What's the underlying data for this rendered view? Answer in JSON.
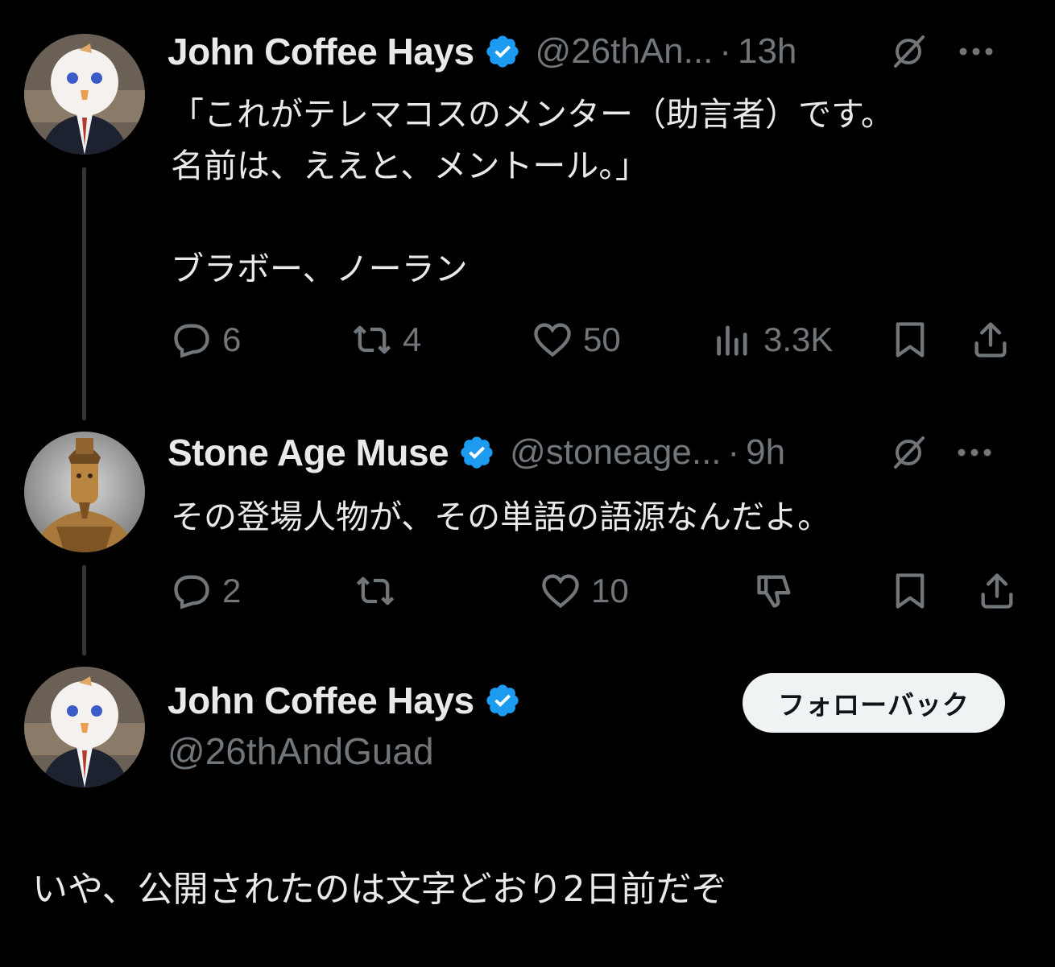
{
  "tweets": [
    {
      "name": "John Coffee Hays",
      "handle": "@26thAn...",
      "separator": "·",
      "time": "13h",
      "text": "「これがテレマコスのメンター（助言者）です。\n名前は、ええと、メントール。」\n\nブラボー、ノーラン",
      "replies": "6",
      "reposts": "4",
      "likes": "50",
      "views": "3.3K"
    },
    {
      "name": "Stone Age Muse",
      "handle": "@stoneage...",
      "separator": "·",
      "time": "9h",
      "text": "その登場人物が、その単語の語源なんだよ。",
      "replies": "2",
      "reposts": "",
      "likes": "10"
    }
  ],
  "main": {
    "name": "John Coffee Hays",
    "handle": "@26thAndGuad",
    "follow_label": "フォローバック",
    "text": "いや、公開されたのは文字どおり2日前だぞ"
  },
  "colors": {
    "background": "#000000",
    "text": "#e7e9ea",
    "muted": "#71767b",
    "verified": "#1d9bf0",
    "thread_line": "#333639"
  },
  "icons": [
    "verified-badge-icon",
    "grok-icon",
    "more-icon",
    "reply-icon",
    "repost-icon",
    "like-icon",
    "views-icon",
    "downvote-icon",
    "bookmark-icon",
    "share-icon"
  ]
}
